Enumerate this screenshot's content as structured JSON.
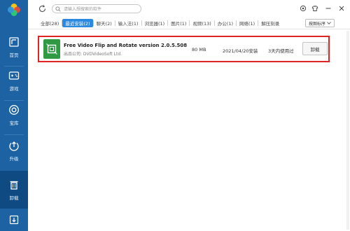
{
  "search": {
    "placeholder": "请输入想搜索的软件"
  },
  "sidebar": {
    "items": [
      {
        "label": "首页",
        "icon": "home-icon"
      },
      {
        "label": "游戏",
        "icon": "gamepad-icon"
      },
      {
        "label": "宝库",
        "icon": "treasure-icon"
      },
      {
        "label": "升级",
        "icon": "upgrade-icon"
      },
      {
        "label": "卸载",
        "icon": "trash-icon"
      }
    ],
    "bottom_icon": "download-icon"
  },
  "tabs": [
    {
      "label": "全部(28)"
    },
    {
      "label": "最近安装(2)",
      "active": true
    },
    {
      "label": "聊天(2)"
    },
    {
      "label": "输入法(1)"
    },
    {
      "label": "浏览器(1)"
    },
    {
      "label": "图片(1)"
    },
    {
      "label": "视频(13)"
    },
    {
      "label": "办公(1)"
    },
    {
      "label": "网络(1)"
    },
    {
      "label": "解压刻录"
    }
  ],
  "sort": {
    "label": "按图标序"
  },
  "app": {
    "name": "Free Video Flip and Rotate version 2.0.5.508",
    "company": "出品公司: DVDVideoSoft Ltd.",
    "size": "80 MB",
    "date": "2021/04/20安装",
    "usage": "3天内使用过",
    "uninstall_label": "卸载"
  },
  "colors": {
    "sidebar": "#1d63a3",
    "sidebar_active": "#0f4a82",
    "tab_active": "#2b8ae0",
    "highlight_border": "#e02424",
    "app_icon": "#2f9a43"
  }
}
